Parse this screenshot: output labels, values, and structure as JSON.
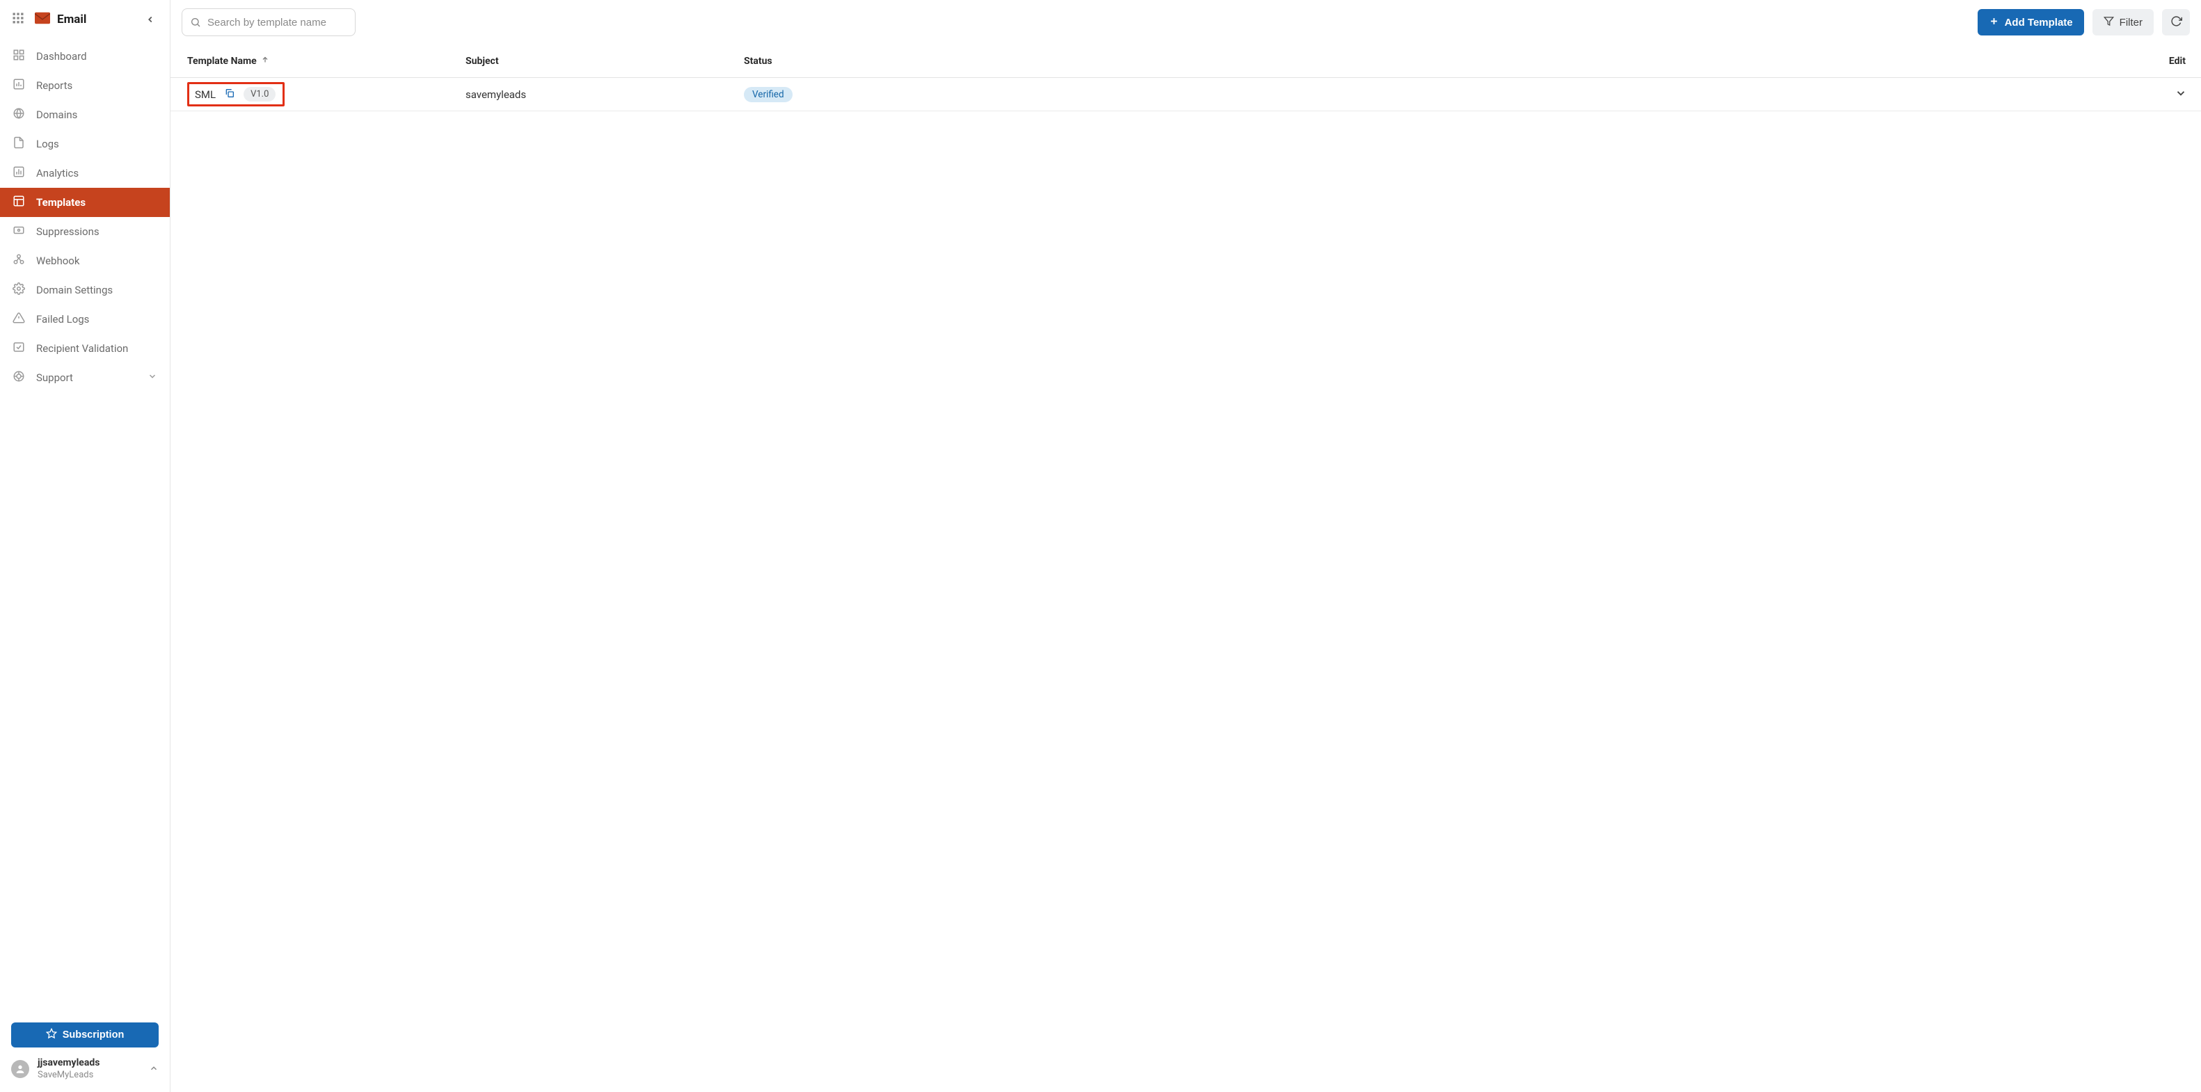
{
  "brand": {
    "title": "Email"
  },
  "sidebar": {
    "items": [
      {
        "label": "Dashboard"
      },
      {
        "label": "Reports"
      },
      {
        "label": "Domains"
      },
      {
        "label": "Logs"
      },
      {
        "label": "Analytics"
      },
      {
        "label": "Templates"
      },
      {
        "label": "Suppressions"
      },
      {
        "label": "Webhook"
      },
      {
        "label": "Domain Settings"
      },
      {
        "label": "Failed Logs"
      },
      {
        "label": "Recipient Validation"
      },
      {
        "label": "Support"
      }
    ],
    "subscription_label": "Subscription",
    "user": {
      "name": "jjsavemyleads",
      "org": "SaveMyLeads"
    }
  },
  "topbar": {
    "search_placeholder": "Search by template name",
    "add_template_label": "Add Template",
    "filter_label": "Filter"
  },
  "table": {
    "columns": {
      "name": "Template Name",
      "subject": "Subject",
      "status": "Status",
      "edit": "Edit"
    },
    "rows": [
      {
        "name": "SML",
        "version": "V1.0",
        "subject": "savemyleads",
        "status": "Verified"
      }
    ]
  }
}
